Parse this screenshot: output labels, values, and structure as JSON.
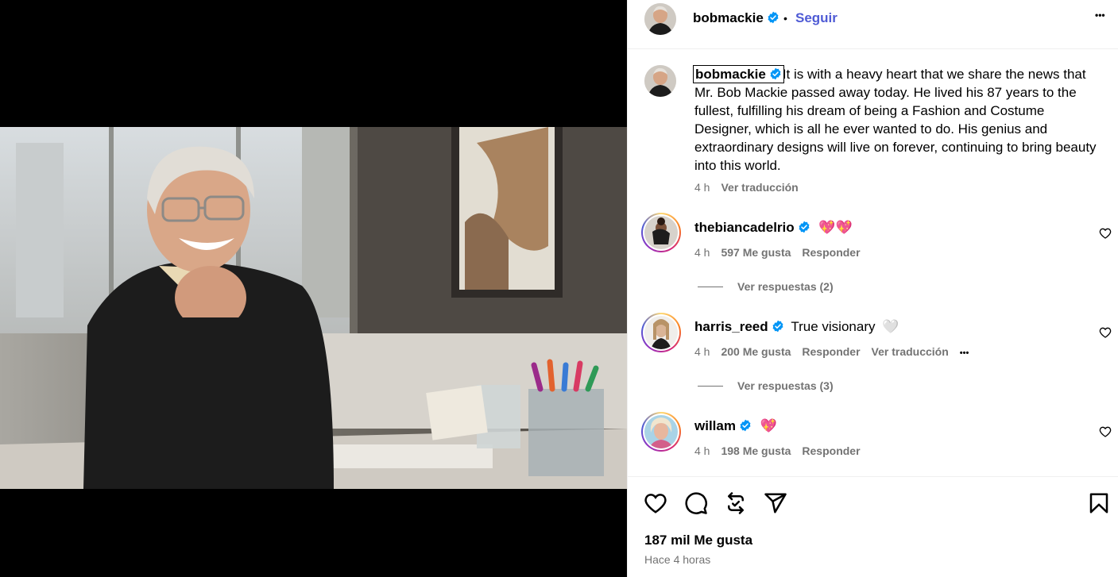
{
  "post": {
    "author": "bobmackie",
    "separator": "•",
    "follow_label": "Seguir",
    "more_label": "•••",
    "caption_text": "It is with a heavy heart that we share the news that Mr. Bob Mackie passed away today. He lived his 87 years to the fullest, fulfilling his dream of being a Fashion and Costume Designer, which is all he ever wanted to do. His genius and extraordinary designs will live on forever, continuing to bring beauty into this world.",
    "caption_time": "4 h",
    "caption_translate": "Ver traducción",
    "likes": "187 mil Me gusta",
    "posted": "Hace 4 horas"
  },
  "comments": [
    {
      "user": "thebiancadelrio",
      "text": "",
      "emoji": "💖💖",
      "time": "4 h",
      "likes": "597 Me gusta",
      "reply": "Responder",
      "view_replies": "Ver respuestas (2)"
    },
    {
      "user": "harris_reed",
      "text": "True visionary",
      "emoji": "🤍",
      "time": "4 h",
      "likes": "200 Me gusta",
      "reply": "Responder",
      "translate": "Ver traducción",
      "options": "•••",
      "view_replies": "Ver respuestas (3)"
    },
    {
      "user": "willam",
      "text": "",
      "emoji": "💖",
      "time": "4 h",
      "likes": "198 Me gusta",
      "reply": "Responder"
    }
  ],
  "colors": {
    "accent": "#4f5bd5",
    "verified": "#0095f6",
    "heart": "#ed4956",
    "muted": "#737373"
  },
  "icons": [
    "verified-badge-icon",
    "like-icon",
    "comment-icon",
    "repost-icon",
    "share-icon",
    "save-icon",
    "heart-outline-icon"
  ]
}
